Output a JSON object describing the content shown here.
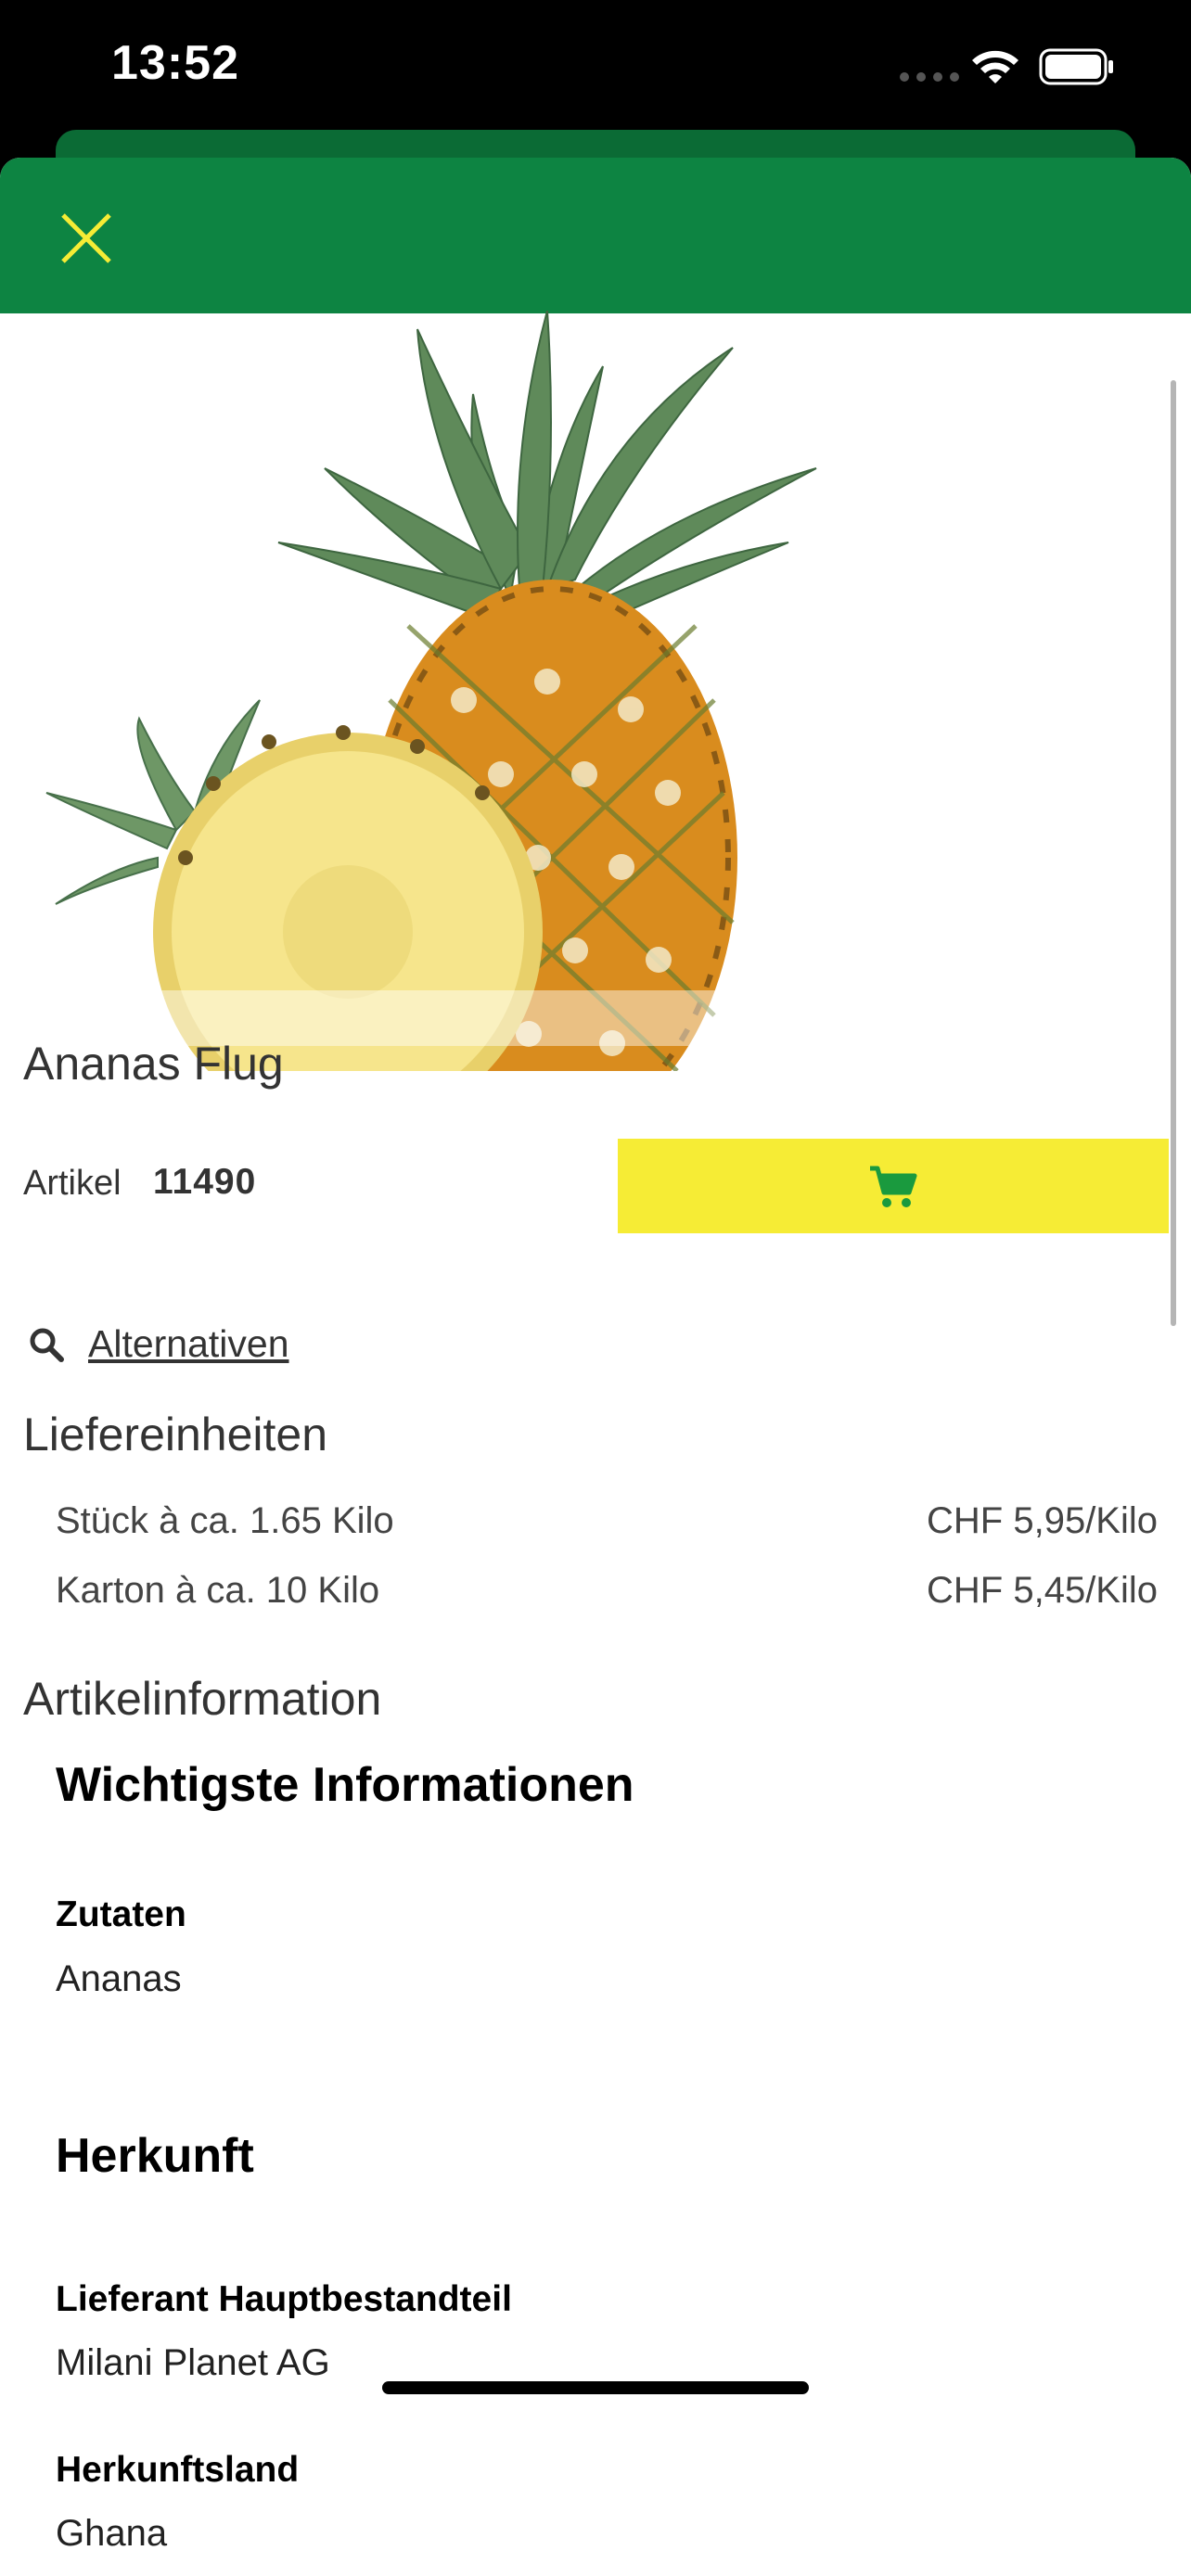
{
  "status_bar": {
    "time": "13:52"
  },
  "product": {
    "title": "Ananas Flug",
    "article_label": "Artikel",
    "article_number": "11490"
  },
  "alternatives": {
    "label": "Alternativen"
  },
  "delivery_units": {
    "title": "Liefereinheiten",
    "rows": [
      {
        "name": "Stück à ca. 1.65 Kilo",
        "price": "CHF 5,95/Kilo"
      },
      {
        "name": "Karton à ca. 10 Kilo",
        "price": "CHF 5,45/Kilo"
      }
    ]
  },
  "article_info": {
    "title": "Artikelinformation",
    "key_info": {
      "heading": "Wichtigste Informationen",
      "ingredients_label": "Zutaten",
      "ingredients_value": "Ananas"
    },
    "origin": {
      "heading": "Herkunft",
      "supplier_label": "Lieferant Hauptbestandteil",
      "supplier_value": "Milani Planet AG",
      "country_label": "Herkunftsland",
      "country_value": "Ghana"
    }
  },
  "colors": {
    "header_green": "#0d8442",
    "close_icon": "#f6ec35",
    "cart_button": "#f6ec35",
    "cart_icon": "#1a9a3e"
  },
  "icons": {
    "close": "close-icon",
    "cart": "shopping-cart-icon",
    "search": "search-icon",
    "wifi": "wifi-icon",
    "battery": "battery-icon"
  }
}
